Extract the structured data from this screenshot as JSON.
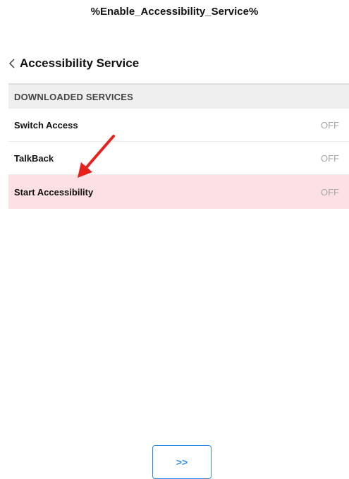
{
  "title": "%Enable_Accessibility_Service%",
  "header": {
    "title": "Accessibility Service",
    "back_icon": "chevron-left-icon"
  },
  "section": {
    "header": "DOWNLOADED SERVICES",
    "items": [
      {
        "label": "Switch Access",
        "status": "OFF",
        "highlighted": false
      },
      {
        "label": "TalkBack",
        "status": "OFF",
        "highlighted": false
      },
      {
        "label": "Start Accessibility",
        "status": "OFF",
        "highlighted": true
      }
    ]
  },
  "annotation": {
    "icon": "red-arrow-icon",
    "color": "#e8201c"
  },
  "next_button": {
    "label": ">>",
    "color": "#2b8be6"
  },
  "colors": {
    "highlight": "#fde0e3",
    "section_bg": "#efefef",
    "status_text": "#a6a6a6"
  }
}
